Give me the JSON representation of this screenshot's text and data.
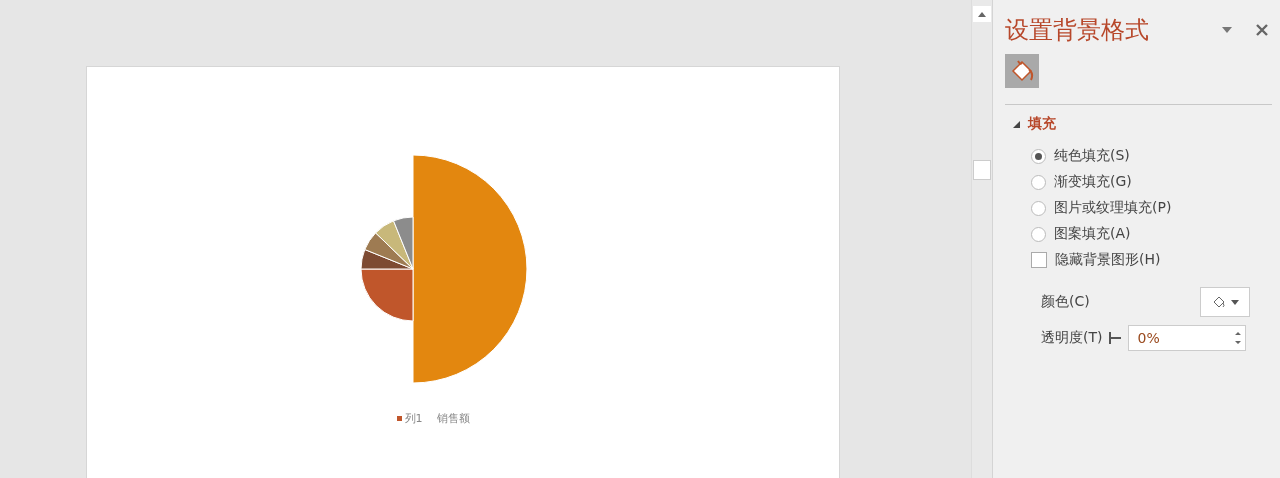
{
  "slide": {
    "legend": [
      {
        "label": "列1",
        "color": "#c0562b"
      },
      {
        "label": "销售额"
      }
    ]
  },
  "panel": {
    "title": "设置背景格式",
    "section": {
      "title": "填充",
      "expanded": true,
      "options": [
        {
          "kind": "radio",
          "label": "纯色填充(S)",
          "selected": true
        },
        {
          "kind": "radio",
          "label": "渐变填充(G)",
          "selected": false
        },
        {
          "kind": "radio",
          "label": "图片或纹理填充(P)",
          "selected": false
        },
        {
          "kind": "radio",
          "label": "图案填充(A)",
          "selected": false
        },
        {
          "kind": "checkbox",
          "label": "隐藏背景图形(H)",
          "checked": false
        }
      ],
      "color_label": "颜色(C)",
      "transparency_label": "透明度(T)",
      "transparency_value": "0%"
    }
  }
}
